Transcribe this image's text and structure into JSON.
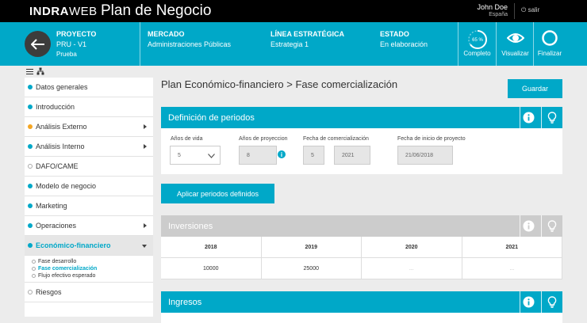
{
  "header": {
    "logo_bold": "INDRA",
    "logo_light": "WEB",
    "app_title": "Plan de Negocio",
    "user_name": "John Doe",
    "user_country": "España",
    "logout_label": "salir"
  },
  "project": {
    "proyecto_label": "PROYECTO",
    "proyecto_code": "PRU - V1",
    "proyecto_name": "Prueba",
    "mercado_label": "MERCADO",
    "mercado_value": "Administraciones Públicas",
    "linea_label": "LÍNEA ESTRATÉGICA",
    "linea_value": "Estrategia 1",
    "estado_label": "ESTADO",
    "estado_value": "En elaboración",
    "actions": {
      "completo_label": "Completo",
      "completo_percent": "65 %",
      "completo_fraction": 0.65,
      "visualizar_label": "Visualizar",
      "finalizar_label": "Finalizar"
    }
  },
  "sidebar": {
    "items": [
      {
        "label": "Datos generales",
        "status": "done"
      },
      {
        "label": "Introducción",
        "status": "done"
      },
      {
        "label": "Análisis Externo",
        "status": "partial"
      },
      {
        "label": "Análisis Interno",
        "status": "done"
      },
      {
        "label": "DAFO/CAME",
        "status": "empty"
      },
      {
        "label": "Modelo de negocio",
        "status": "done"
      },
      {
        "label": "Marketing",
        "status": "done"
      },
      {
        "label": "Operaciones",
        "status": "done"
      },
      {
        "label": "Económico-financiero",
        "status": "active"
      }
    ],
    "subitems": [
      {
        "label": "Fase desarrollo"
      },
      {
        "label": "Fase comercialización"
      },
      {
        "label": "Flujo efectivo esperado"
      }
    ],
    "after_items": [
      {
        "label": "Riesgos",
        "status": "empty"
      }
    ]
  },
  "main": {
    "title": "Plan Económico-financiero > Fase comercialización",
    "save_label": "Guardar",
    "periodos": {
      "header": "Definición de periodos",
      "anos_vida_label": "Años de vida",
      "anos_vida_value": "5",
      "anos_proyeccion_label": "Años de proyeccion",
      "anos_proyeccion_value": "8",
      "fecha_comercializacion_label": "Fecha de comercialización",
      "fecha_comercializacion_num": "5",
      "fecha_comercializacion_year": "2021",
      "fecha_inicio_label": "Fecha de inicio de proyecto",
      "fecha_inicio_value": "21/06/2018"
    },
    "apply_label": "Aplicar periodos definidos",
    "inversiones": {
      "header": "Inversiones",
      "columns": [
        "2018",
        "2019",
        "2020",
        "2021"
      ],
      "values": [
        "10000",
        "25000",
        "...",
        "..."
      ]
    },
    "ingresos": {
      "header": "Ingresos"
    }
  }
}
